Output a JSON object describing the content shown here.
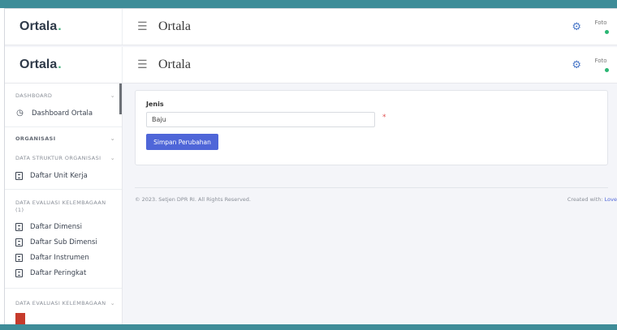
{
  "brand": {
    "name": "Ortala",
    "dot": "."
  },
  "header": {
    "title": "Ortala",
    "avatar_alt": "Foto"
  },
  "sidebar": {
    "dashboard_section": "DASHBOARD",
    "dashboard_item": "Dashboard Ortala",
    "organisasi_section": "ORGANISASI",
    "struktur_section": "DATA STRUKTUR ORGANISASI",
    "unit_kerja_item": "Daftar Unit Kerja",
    "evaluasi1_section_line1": "DATA EVALUASI KELEMBAGAAN",
    "evaluasi1_section_line2": "(1)",
    "evaluasi_items": [
      "Daftar Dimensi",
      "Daftar Sub Dimensi",
      "Daftar Instrumen",
      "Daftar Peringkat"
    ],
    "evaluasi2_section": "DATA EVALUASI KELEMBAGAAN"
  },
  "form": {
    "jenis_label": "Jenis",
    "jenis_value": "Baju",
    "required_mark": "*",
    "submit_label": "Simpan Perubahan"
  },
  "footer": {
    "copyright": "© 2023. Setjen DPR RI. All Rights Reserved.",
    "created_prefix": "Created with: ",
    "created_link": "Love"
  }
}
